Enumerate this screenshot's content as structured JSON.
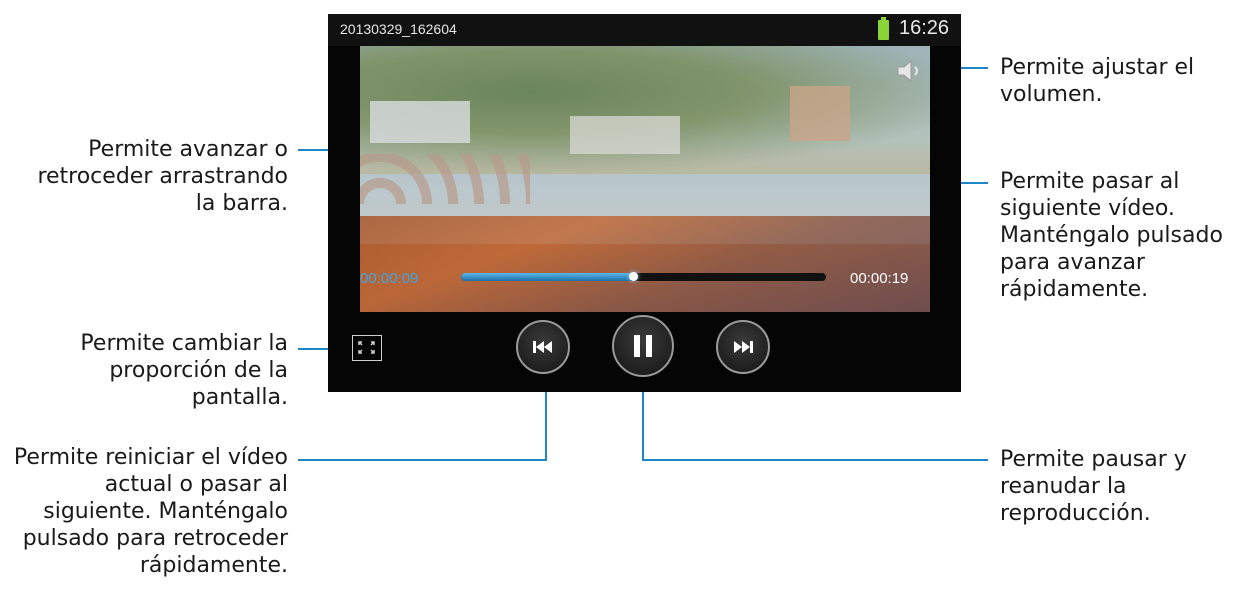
{
  "screen": {
    "filename": "20130329_162604",
    "clock": "16:26",
    "battery_color": "#8cd33a"
  },
  "player": {
    "time_elapsed": "00:00:09",
    "time_total": "00:00:19",
    "progress_fraction": 0.47,
    "accent_color": "#3ea7e0",
    "icons": {
      "volume": "speaker-icon",
      "ratio": "aspect-ratio-icon",
      "previous": "skip-previous-icon",
      "pause": "pause-icon",
      "next": "skip-next-icon"
    }
  },
  "callouts": {
    "seek": [
      "Permite avanzar o",
      "retroceder arrastrando",
      "la barra."
    ],
    "ratio": [
      "Permite cambiar la",
      "proporción de la",
      "pantalla."
    ],
    "previous": [
      "Permite reiniciar el vídeo",
      "actual o pasar al",
      "siguiente. Manténgalo",
      "pulsado para retroceder",
      "rápidamente."
    ],
    "volume": [
      "Permite ajustar el",
      "volumen."
    ],
    "next": [
      "Permite pasar al",
      "siguiente vídeo.",
      "Manténgalo pulsado",
      "para avanzar",
      "rápidamente."
    ],
    "pause": [
      "Permite pausar y",
      "reanudar la",
      "reproducción."
    ],
    "line_color": "#1f86c7"
  }
}
